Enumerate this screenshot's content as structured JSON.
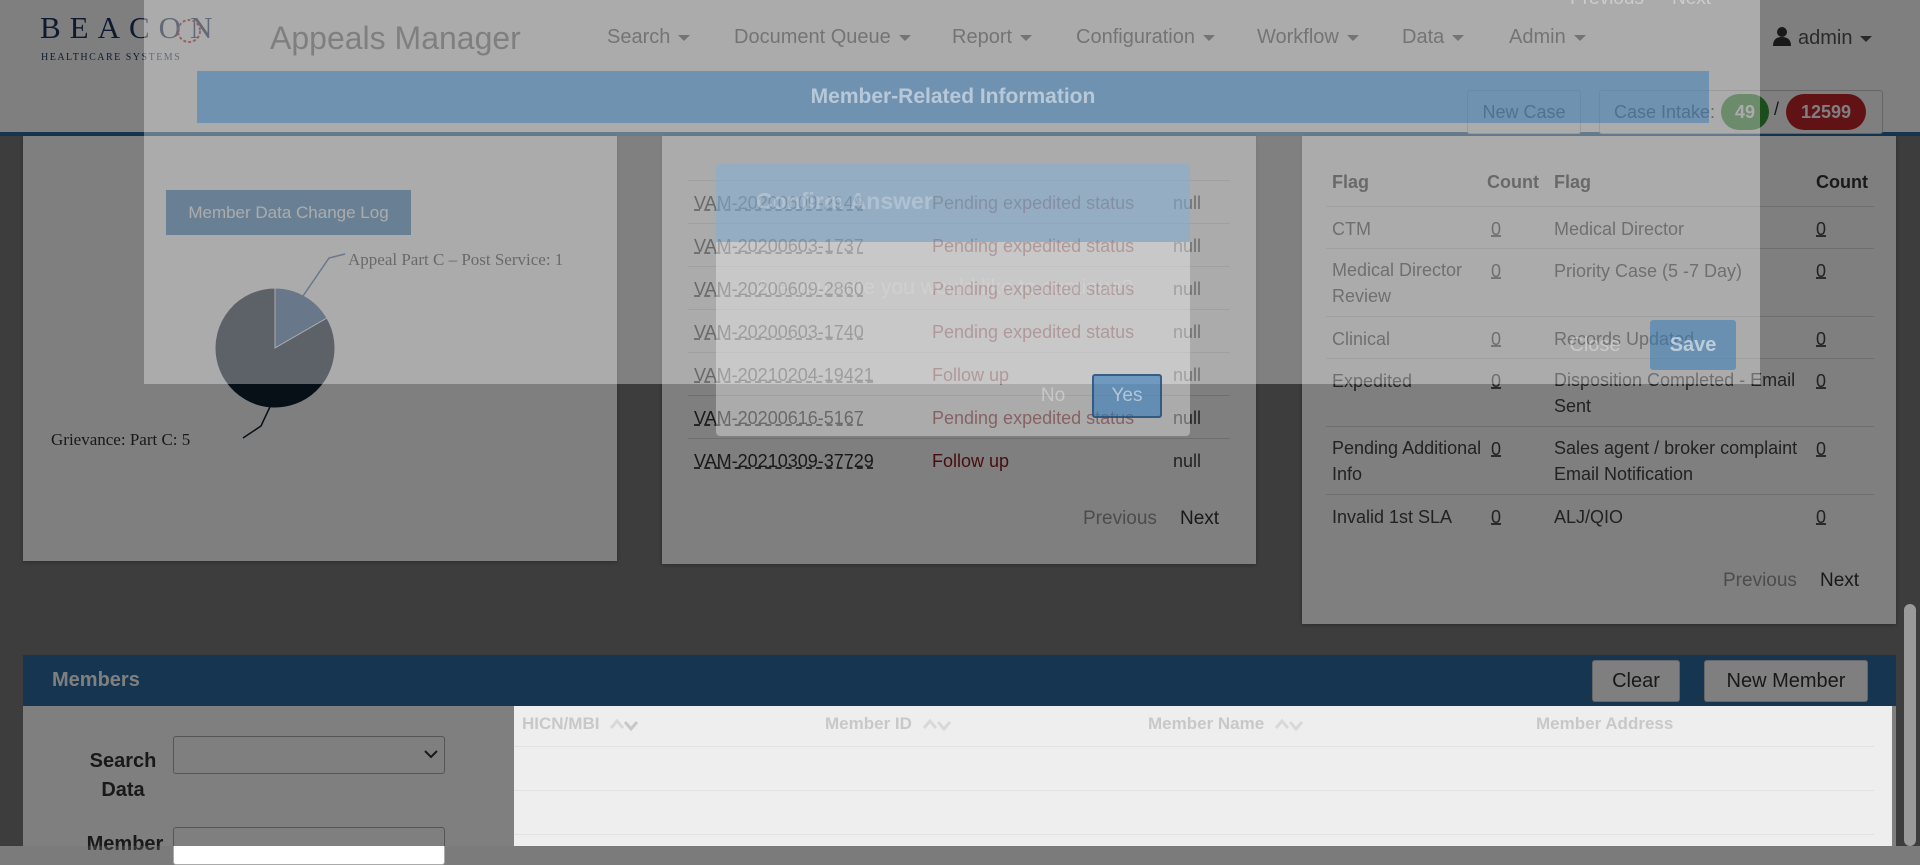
{
  "header": {
    "logo_text": "BEACON",
    "logo_subtext": "HEALTHCARE SYSTEMS",
    "app_title": "Appeals Manager",
    "nav": [
      "Search",
      "Document Queue",
      "Report",
      "Configuration",
      "Workflow",
      "Data",
      "Admin"
    ],
    "user": "admin",
    "new_case_label": "New Case",
    "case_intake_label": "Case Intake:",
    "case_intake_count_a": "49",
    "case_intake_separator": "/",
    "case_intake_count_b": "12599"
  },
  "background_pager": {
    "previous": "Previous",
    "next": "Next"
  },
  "modal_back": {
    "title": "Member-Related Information",
    "close_label": "Close",
    "save_label": "Save"
  },
  "modal_front": {
    "title": "Confirm Answer",
    "message": "Are you sure you would like to continue?",
    "no_label": "No",
    "yes_label": "Yes"
  },
  "chart_panel": {
    "change_log_button": "Member Data Change Log",
    "chart_data": {
      "type": "pie",
      "title": "",
      "slices": [
        {
          "label": "Appeal Part C - Post Service",
          "value": 1,
          "display": "Appeal Part C – Post Service: 1",
          "color": "#2e5d94"
        },
        {
          "label": "Grievance: Part C",
          "value": 5,
          "display": "Grievance: Part C: 5",
          "color": "#0f1f2f"
        }
      ]
    }
  },
  "cases_panel": {
    "rows": [
      {
        "id": "VAM-20200609-2949",
        "status": "Pending expedited status",
        "value": "null"
      },
      {
        "id": "VAM-20200603-1737",
        "status": "Pending expedited status",
        "value": "null"
      },
      {
        "id": "VAM-20200609-2860",
        "status": "Pending expedited status",
        "value": "null"
      },
      {
        "id": "VAM-20200603-1740",
        "status": "Pending expedited status",
        "value": "null"
      },
      {
        "id": "VAM-20210204-19421",
        "status": "Follow up",
        "value": "null"
      },
      {
        "id": "VAM-20200616-5167",
        "status": "Pending expedited status",
        "value": "null"
      },
      {
        "id": "VAM-20210309-37729",
        "status": "Follow up",
        "value": "null"
      }
    ],
    "previous": "Previous",
    "next": "Next"
  },
  "flags_panel": {
    "headers": [
      "Flag",
      "Count",
      "Flag",
      "Count"
    ],
    "rows": [
      {
        "flag1": "CTM",
        "count1": "0",
        "flag2": "Medical Director",
        "count2": "0"
      },
      {
        "flag1": "Medical Director Review",
        "count1": "0",
        "flag2": "Priority Case (5 -7 Day)",
        "count2": "0"
      },
      {
        "flag1": "Clinical",
        "count1": "0",
        "flag2": "Records Updated",
        "count2": "0"
      },
      {
        "flag1": "Expedited",
        "count1": "0",
        "flag2": "Disposition Completed - Email Sent",
        "count2": "0"
      },
      {
        "flag1": "Pending Additional Info",
        "count1": "0",
        "flag2": "Sales agent / broker complaint Email Notification",
        "count2": "0"
      },
      {
        "flag1": "Invalid 1st SLA",
        "count1": "0",
        "flag2": "ALJ/QIO",
        "count2": "0"
      }
    ],
    "previous": "Previous",
    "next": "Next"
  },
  "members": {
    "title": "Members",
    "clear_label": "Clear",
    "new_member_label": "New Member",
    "search_data_label": "Search Data",
    "next_field_label": "Member",
    "columns": [
      "HICN/MBI",
      "Member ID",
      "Member Name",
      "Member Address"
    ]
  },
  "colors": {
    "accent": "#2a6ba3",
    "status_red": "#8b1a1a",
    "intake_green": "#3a9a3a",
    "intake_red": "#c0252b",
    "primary_button": "#337ab7"
  }
}
